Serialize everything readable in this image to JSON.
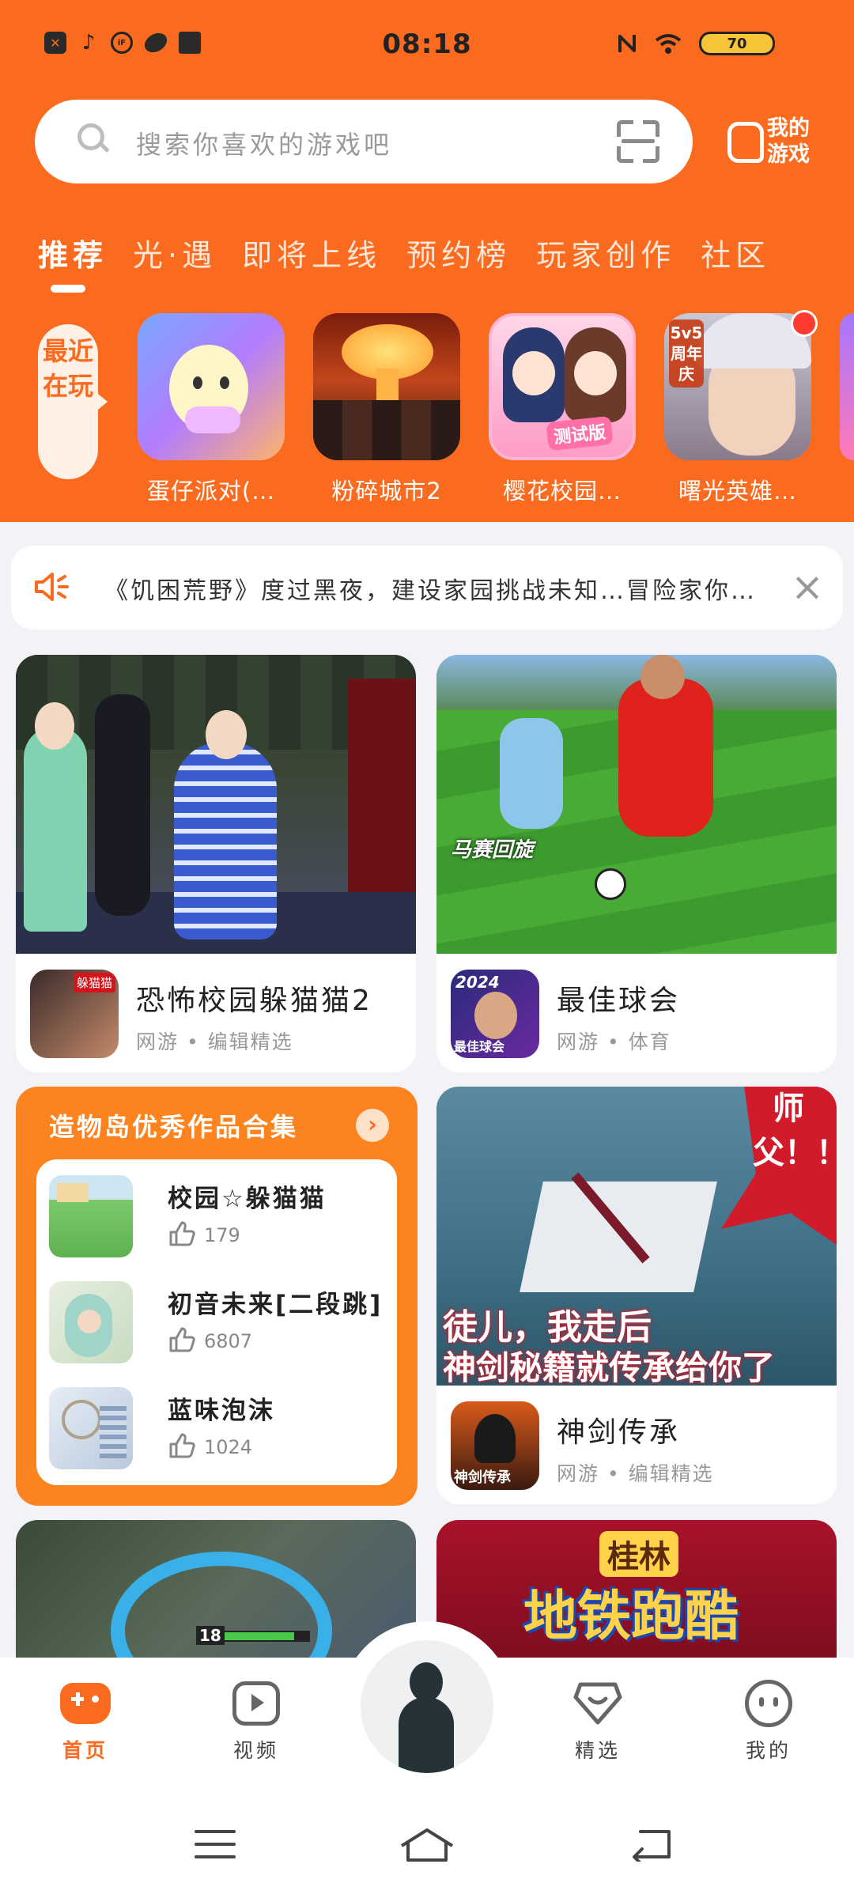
{
  "status_bar": {
    "time": "08:18",
    "battery": "70",
    "left_icons": [
      "x-app-icon",
      "tiktok-icon",
      "iflytek-icon",
      "rugby-icon",
      "book-icon"
    ],
    "right_icons": [
      "nfc-icon",
      "wifi-icon",
      "battery-icon"
    ]
  },
  "search": {
    "placeholder": "搜索你喜欢的游戏吧"
  },
  "my_games": {
    "label": "我的游戏"
  },
  "tabs": [
    {
      "label": "推荐",
      "active": true
    },
    {
      "label": "光·遇",
      "active": false
    },
    {
      "label": "即将上线",
      "active": false
    },
    {
      "label": "预约榜",
      "active": false
    },
    {
      "label": "玩家创作",
      "active": false
    },
    {
      "label": "社区",
      "active": false
    }
  ],
  "recent": {
    "label": "最近在玩",
    "items": [
      {
        "name": "蛋仔派对(…"
      },
      {
        "name": "粉碎城市2"
      },
      {
        "name": "樱花校园…",
        "badge": "测试版"
      },
      {
        "name": "曙光英雄…",
        "badge": "5v5 周年庆"
      }
    ]
  },
  "announcement": {
    "text": "《饥困荒野》度过黑夜，建设家园挑战未知…冒险家你…"
  },
  "cards": [
    {
      "title": "恐怖校园躲猫猫2",
      "sub": "网游 • 编辑精选",
      "icon_text": "躲猫猫"
    },
    {
      "title": "最佳球会",
      "sub": "网游 • 体育",
      "image_caption": "马赛回旋",
      "icon_text": "最佳球会",
      "icon_badge": "2024"
    },
    {
      "title": "神剑传承",
      "sub": "网游 • 编辑精选",
      "image_caption_1": "徒儿，我走后",
      "image_caption_2": "神剑秘籍就传承给你了",
      "image_bubble": "师父！！",
      "icon_text": "神剑传承"
    }
  ],
  "collection": {
    "title": "造物岛优秀作品合集",
    "items": [
      {
        "name": "校园☆躲猫猫",
        "likes": "179"
      },
      {
        "name": "初音未来[二段跳]",
        "likes": "6807"
      },
      {
        "name": "蓝味泡沫",
        "likes": "1024"
      }
    ]
  },
  "bottom_banner": {
    "text_1": "桂林",
    "text_2": "地铁跑酷",
    "hp_level": "18"
  },
  "bottom_nav": [
    {
      "label": "首页",
      "active": true
    },
    {
      "label": "视频",
      "active": false
    },
    {
      "label": "精选",
      "active": false
    },
    {
      "label": "我的",
      "active": false
    }
  ],
  "colors": {
    "accent": "#fb6b1f",
    "background": "#f3f2f6"
  }
}
